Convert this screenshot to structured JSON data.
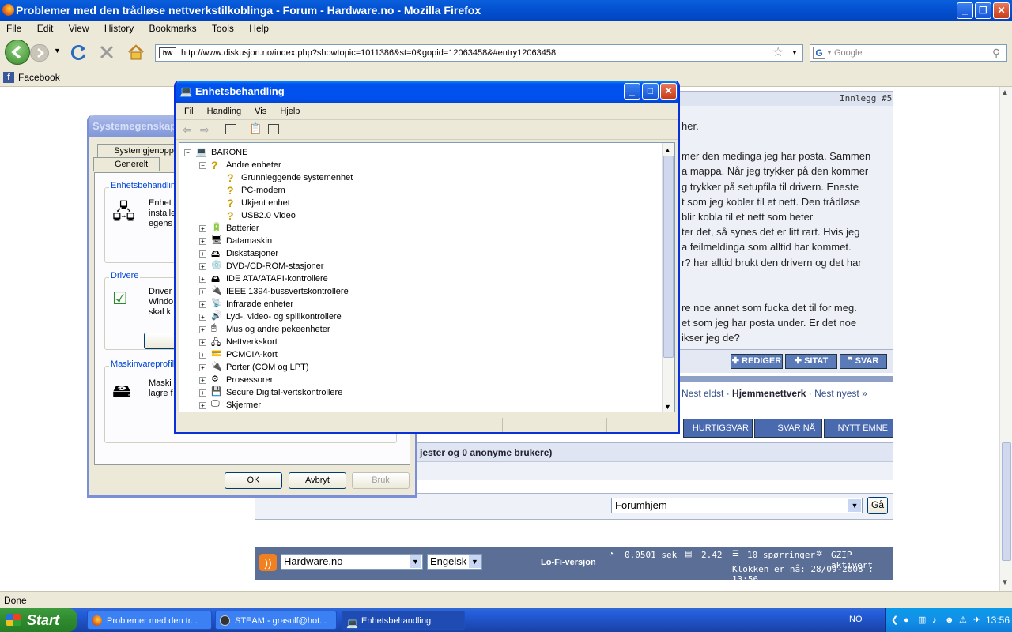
{
  "browser": {
    "title": "Problemer med den trådløse nettverkstilkoblinga - Forum - Hardware.no - Mozilla Firefox",
    "menu": [
      "File",
      "Edit",
      "View",
      "History",
      "Bookmarks",
      "Tools",
      "Help"
    ],
    "url": "http://www.diskusjon.no/index.php?showtopic=1011386&st=0&gopid=12063458&#entry12063458",
    "search_placeholder": "Google",
    "bookmark": "Facebook",
    "status": "Done"
  },
  "forum": {
    "post_number": "Innlegg #5",
    "lines": [
      "her.",
      "mer den medinga jeg har posta. Sammen",
      "a mappa. Når jeg trykker på den kommer",
      "g trykker på setupfila til drivern. Eneste",
      "t som jeg kobler til et nett. Den trådløse",
      "blir kobla til et nett som heter",
      "ter det, så synes det er litt rart. Hvis jeg",
      "a feilmeldinga som alltid har kommet.",
      "r? har alltid brukt den drivern og det har",
      "re noe annet som fucka det til for meg.",
      "et som jeg har posta under. Er det noe",
      "ikser jeg de?"
    ],
    "buttons": [
      "REDIGER",
      "SITAT",
      "SVAR"
    ],
    "nav_prev": "Nest eldst",
    "nav_home": "Hjemmenettverk",
    "nav_next": "Nest nyest »",
    "action_buttons": [
      "HURTIGSVAR",
      "SVAR NÅ",
      "NYTT EMNE"
    ],
    "users_text": "jester og 0 anonyme brukere)",
    "forum_select": "Forumhjem",
    "go": "Gå",
    "footer_site": "Hardware.no",
    "footer_lang": "Engelsk",
    "lofi": "Lo-Fi-versjon",
    "time": "0.0501 sek",
    "load": "2.42",
    "queries": "10 spørringer",
    "gzip": "GZIP aktivert",
    "clock": "Klokken er nå: 28/09-2008 : 13:56"
  },
  "sysprops": {
    "title": "Systemegenskape",
    "tabs": [
      "Systemgjenoppr",
      "Generelt"
    ],
    "group1_title": "Enhetsbehandlin",
    "group1_lines": [
      "Enhet",
      "installe",
      "egens"
    ],
    "group2_title": "Drivere",
    "group2_lines": [
      "Driver",
      "Windo",
      "skal k"
    ],
    "group3_title": "Maskinvareprofil",
    "group3_lines": [
      "Maski",
      "lagre f"
    ],
    "ok": "OK",
    "cancel": "Avbryt",
    "apply": "Bruk"
  },
  "devmgr": {
    "title": "Enhetsbehandling",
    "menu": [
      "Fil",
      "Handling",
      "Vis",
      "Hjelp"
    ],
    "root": "BARONE",
    "other_devices": "Andre enheter",
    "other_children": [
      "Grunnleggende systemenhet",
      "PC-modem",
      "Ukjent enhet",
      "USB2.0 Video"
    ],
    "categories": [
      "Batterier",
      "Datamaskin",
      "Diskstasjoner",
      "DVD-/CD-ROM-stasjoner",
      "IDE ATA/ATAPI-kontrollere",
      "IEEE 1394-bussvertskontrollere",
      "Infrarøde enheter",
      "Lyd-, video- og spillkontrollere",
      "Mus og andre pekeenheter",
      "Nettverkskort",
      "PCMCIA-kort",
      "Porter (COM og LPT)",
      "Prosessorer",
      "Secure Digital-vertskontrollere",
      "Skjermer"
    ]
  },
  "taskbar": {
    "start": "Start",
    "tasks": [
      "Problemer med den tr...",
      "STEAM - grasulf@hot...",
      "Enhetsbehandling"
    ],
    "lang": "NO",
    "clock": "13:56"
  }
}
